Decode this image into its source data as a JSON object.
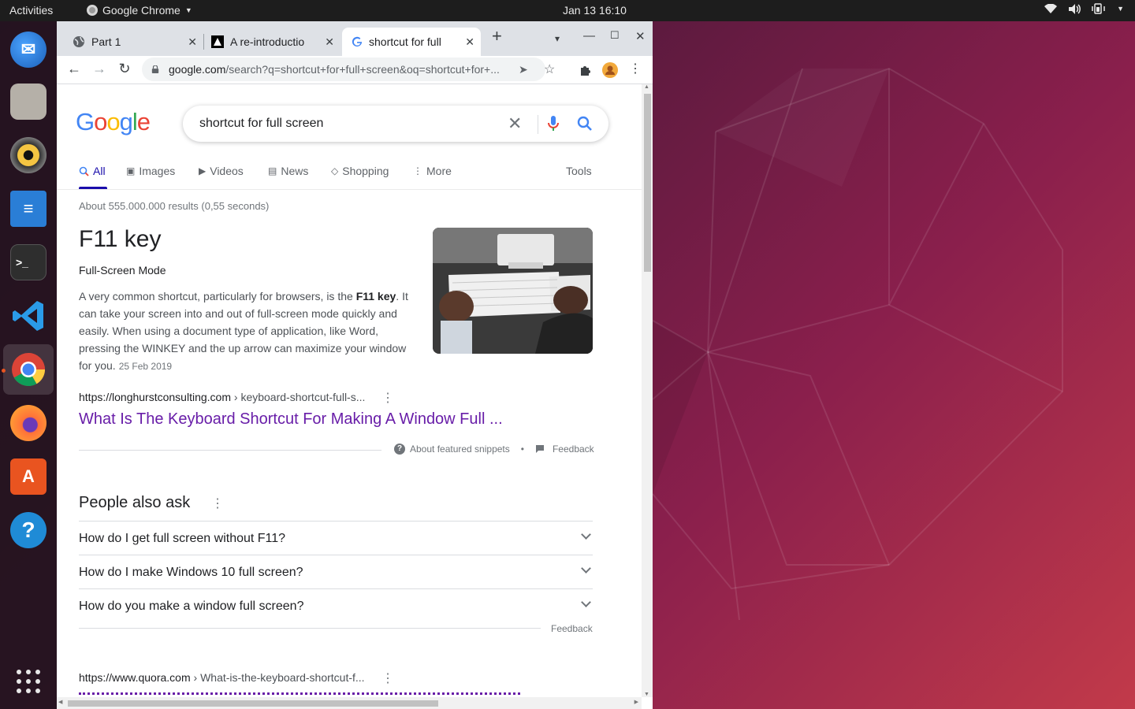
{
  "topbar": {
    "activities": "Activities",
    "app_name": "Google Chrome",
    "clock": "Jan 13  16:10"
  },
  "dock": {
    "items": [
      "thunderbird",
      "files",
      "rhythmbox",
      "libreoffice-writer",
      "terminal",
      "vscode",
      "chrome",
      "firefox",
      "ubuntu-software",
      "help",
      "show-applications"
    ]
  },
  "browser": {
    "tabs": [
      {
        "label": "Part 1",
        "icon": "globe-icon"
      },
      {
        "label": "A re-introductio",
        "icon": "mdn-icon"
      },
      {
        "label": "shortcut for full",
        "icon": "google-icon"
      }
    ],
    "url_domain": "google.com",
    "url_path": "/search?q=shortcut+for+full+screen&oq=shortcut+for+..."
  },
  "search": {
    "logo": "Google",
    "query": "shortcut for full screen",
    "tabs": [
      "All",
      "Images",
      "Videos",
      "News",
      "Shopping",
      "More"
    ],
    "tools": "Tools",
    "stats": "About 555.000.000 results (0,55 seconds)"
  },
  "featured": {
    "title": "F11 key",
    "subtitle": "Full-Screen Mode",
    "text_before": "A very common shortcut, particularly for browsers, is the ",
    "text_bold": "F11 key",
    "text_after": ". It can take your screen into and out of full-screen mode quickly and easily. When using a document type of application, like Word, pressing the WINKEY and the up arrow can maximize your window for you.",
    "date": "25 Feb 2019",
    "cite_host": "https://longhurstconsulting.com",
    "cite_path": " › keyboard-shortcut-full-s...",
    "link": "What Is The Keyboard Shortcut For Making A Window Full ...",
    "about": "About featured snippets",
    "bullet": "•",
    "feedback": "Feedback"
  },
  "paa": {
    "title": "People also ask",
    "questions": [
      "How do I get full screen without F11?",
      "How do I make Windows 10 full screen?",
      "How do you make a window full screen?"
    ],
    "feedback": "Feedback"
  },
  "result2": {
    "cite_host": "https://www.quora.com",
    "cite_path": " › What-is-the-keyboard-shortcut-f..."
  },
  "colors": {
    "link": "#1a0dab",
    "visited": "#681da8",
    "ubuntu_orange": "#e95420"
  }
}
